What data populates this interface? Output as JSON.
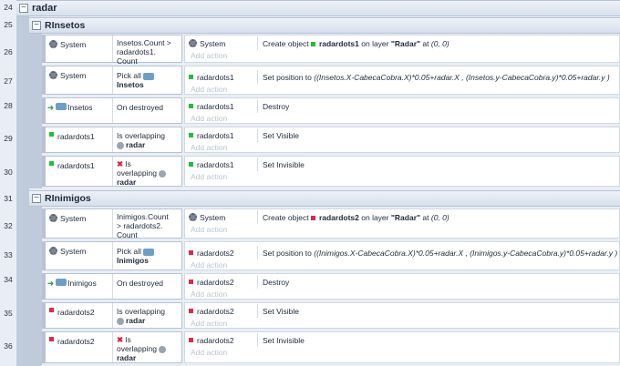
{
  "line_numbers": {
    "l24": "24",
    "l25": "25",
    "l26": "26",
    "l27": "27",
    "l28": "28",
    "l29": "29",
    "l30": "30",
    "l31": "31",
    "l32": "32",
    "l33": "33",
    "l34": "34",
    "l35": "35",
    "l36": "36"
  },
  "groups": {
    "radar": "radar",
    "rinsetos": "RInsetos",
    "rinimigos": "RInimigos"
  },
  "objects": {
    "system": "System",
    "insetos": "Insetos",
    "inimigos": "Inimigos",
    "radardots1": "radardots1",
    "radardots2": "radardots2",
    "radar": "radar"
  },
  "conditions": {
    "insetos_count_a": "Insetos.Count >",
    "insetos_count_b": "radardots1.",
    "insetos_count_c": "Count",
    "inimigos_count_a": "Inimigos.Count",
    "inimigos_count_b": "> radardots2.",
    "inimigos_count_c": "Count",
    "pick_all": "Pick all",
    "on_destroyed": "On destroyed",
    "is_overlapping": "Is overlapping",
    "is": "Is",
    "overlapping": "overlapping"
  },
  "actions": {
    "create_object": "Create object",
    "on_layer": "on layer",
    "layer_name": "\"Radar\"",
    "at": "at",
    "coords": "(0, 0)",
    "set_position_to": "Set position to",
    "pos1": "((Insetos.X-CabecaCobra.X)*0.05+radar.X   , (Insetos.y-CabecaCobra.y)*0.05+radar.y   )",
    "pos2": "((Inimigos.X-CabecaCobra.X)*0.05+radar.X   , (Inimigos.y-CabecaCobra.y)*0.05+radar.y   )",
    "destroy": "Destroy",
    "set_visible": "Set Visible",
    "set_invisible": "Set Invisible",
    "add_action": "Add action"
  },
  "colors": {
    "group_text": "#1e2a3a",
    "dot_green": "#1fbf3a",
    "dot_red": "#e0284a",
    "background": "#e9eef5"
  }
}
